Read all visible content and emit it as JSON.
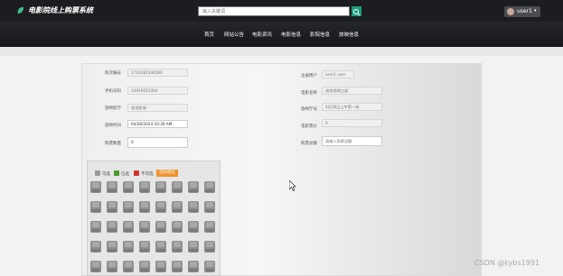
{
  "header": {
    "app_title": "电影院线上购票系统",
    "search_placeholder": "输入关键词",
    "user_name": "user1",
    "logo_icon": "leaf-icon",
    "search_icon": "search-icon"
  },
  "nav": {
    "items": [
      "首页",
      "网站公告",
      "电影资讯",
      "电影信息",
      "影院信息",
      "放映信息"
    ]
  },
  "form": {
    "left": [
      {
        "label": "购次编号",
        "value": "1714282346580",
        "editable": false
      },
      {
        "label": "手机号码",
        "value": "14919053304",
        "editable": false
      },
      {
        "label": "放映影厅",
        "value": "普洛影城",
        "editable": false
      },
      {
        "label": "放映时间",
        "value": "04/28/2024 10:30 AM",
        "editable": true
      },
      {
        "label": "购票数量",
        "value": "0",
        "editable": true
      }
    ],
    "right": [
      {
        "label": "注册用户",
        "value": "user1 user",
        "editable": false
      },
      {
        "label": "电影名称",
        "value": "流浪地球三部",
        "editable": false
      },
      {
        "label": "放映厅号",
        "value": "4月28日上午第一场",
        "editable": false
      },
      {
        "label": "电影票价",
        "value": "0",
        "editable": false
      },
      {
        "label": "购票总额",
        "value": "",
        "placeholder": "请输入购票总额",
        "editable": true
      }
    ]
  },
  "seats": {
    "legend": [
      {
        "label": "可选",
        "color": "#9a9a9a"
      },
      {
        "label": "已选",
        "color": "#4d9a2e"
      },
      {
        "label": "不可选",
        "color": "#d0342c"
      }
    ],
    "pick_button_label": "选好座位",
    "rows": 5,
    "cols": 8
  },
  "watermark": "CSDN @kybs1991"
}
